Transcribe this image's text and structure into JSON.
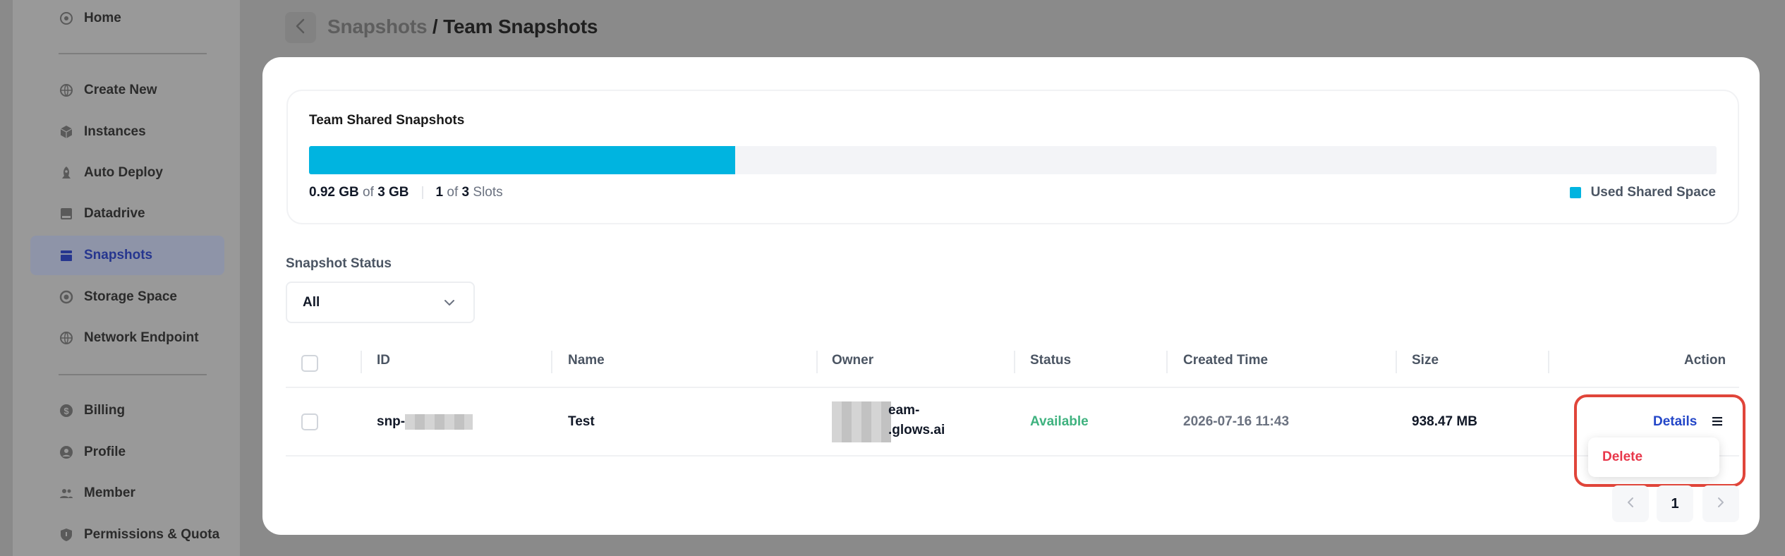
{
  "sidebar": {
    "items": [
      {
        "label": "Home",
        "icon": "home-icon"
      },
      {
        "label": "Create New",
        "icon": "globe-plus-icon"
      },
      {
        "label": "Instances",
        "icon": "cube-icon"
      },
      {
        "label": "Auto Deploy",
        "icon": "rocket-icon"
      },
      {
        "label": "Datadrive",
        "icon": "drive-icon"
      },
      {
        "label": "Snapshots",
        "icon": "snapshot-icon",
        "active": true
      },
      {
        "label": "Storage Space",
        "icon": "storage-icon"
      },
      {
        "label": "Network Endpoint",
        "icon": "network-icon"
      },
      {
        "label": "Billing",
        "icon": "dollar-icon"
      },
      {
        "label": "Profile",
        "icon": "user-icon"
      },
      {
        "label": "Member",
        "icon": "members-icon"
      },
      {
        "label": "Permissions & Quota",
        "icon": "shield-icon"
      }
    ]
  },
  "breadcrumb": {
    "parent": "Snapshots",
    "separator": " / ",
    "current": "Team Snapshots"
  },
  "usage": {
    "title": "Team Shared Snapshots",
    "used": "0.92 GB",
    "of_word": "of",
    "total": "3 GB",
    "slots_used": "1",
    "slots_total": "3",
    "slots_word": "Slots",
    "fill_fraction": 0.303,
    "legend": "Used Shared Space",
    "accent_color": "#00b4e0"
  },
  "filter": {
    "label": "Snapshot Status",
    "selected": "All"
  },
  "table": {
    "columns": [
      "ID",
      "Name",
      "Owner",
      "Status",
      "Created Time",
      "Size",
      "Action"
    ],
    "rows": [
      {
        "id_prefix": "snp-",
        "name": "Test",
        "owner_line1": "eam-",
        "owner_line2": ".glows.ai",
        "status": "Available",
        "created": "2026-07-16 11:43",
        "size": "938.47 MB",
        "action": "Details"
      }
    ]
  },
  "action_menu": {
    "items": [
      "Delete"
    ]
  },
  "pagination": {
    "current_page": "1"
  }
}
